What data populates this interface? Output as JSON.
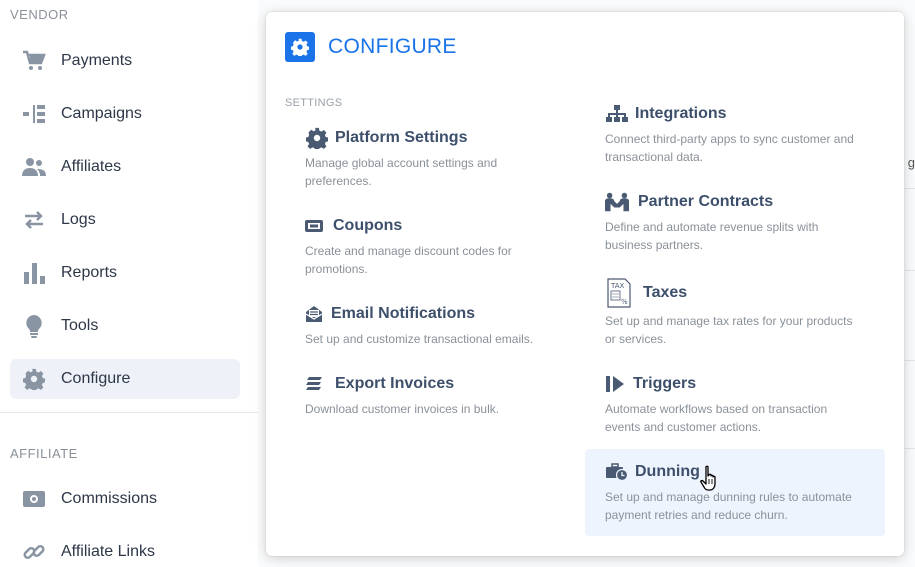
{
  "sidebar": {
    "vendor_label": "VENDOR",
    "affiliate_label": "AFFILIATE",
    "vendor_items": [
      {
        "label": "Payments",
        "icon": "cart-icon"
      },
      {
        "label": "Campaigns",
        "icon": "campaigns-icon"
      },
      {
        "label": "Affiliates",
        "icon": "users-icon"
      },
      {
        "label": "Logs",
        "icon": "arrows-icon"
      },
      {
        "label": "Reports",
        "icon": "bar-chart-icon"
      },
      {
        "label": "Tools",
        "icon": "lightbulb-icon"
      },
      {
        "label": "Configure",
        "icon": "gear-icon",
        "active": true
      }
    ],
    "affiliate_items": [
      {
        "label": "Commissions",
        "icon": "money-icon"
      },
      {
        "label": "Affiliate Links",
        "icon": "link-icon"
      }
    ]
  },
  "background": {
    "peek_text": "g"
  },
  "popup": {
    "title": "CONFIGURE",
    "settings_label": "SETTINGS",
    "left": [
      {
        "title": "Platform Settings",
        "desc": "Manage global account settings and preferences.",
        "icon": "gear-icon"
      },
      {
        "title": "Coupons",
        "desc": "Create and manage discount codes for promotions.",
        "icon": "coupon-icon"
      },
      {
        "title": "Email Notifications",
        "desc": "Set up and customize transactional emails.",
        "icon": "email-icon"
      },
      {
        "title": "Export Invoices",
        "desc": "Download customer invoices in bulk.",
        "icon": "stack-icon"
      }
    ],
    "right": [
      {
        "title": "Integrations",
        "desc": "Connect third-party apps to sync customer and transactional data.",
        "icon": "sitemap-icon"
      },
      {
        "title": "Partner Contracts",
        "desc": "Define and automate revenue splits with business partners.",
        "icon": "partners-icon"
      },
      {
        "title": "Taxes",
        "desc": "Set up and manage tax rates for your products or services.",
        "icon": "tax-icon"
      },
      {
        "title": "Triggers",
        "desc": "Automate workflows based on transaction events and customer actions.",
        "icon": "trigger-icon"
      },
      {
        "title": "Dunning",
        "desc": "Set up and manage dunning rules to automate payment retries and reduce churn.",
        "icon": "briefcase-clock-icon",
        "hover": true
      }
    ]
  },
  "colors": {
    "accent": "#1a73e8",
    "title": "#3d4f6b",
    "muted": "#8a9199",
    "icon": "#8a95a3"
  }
}
